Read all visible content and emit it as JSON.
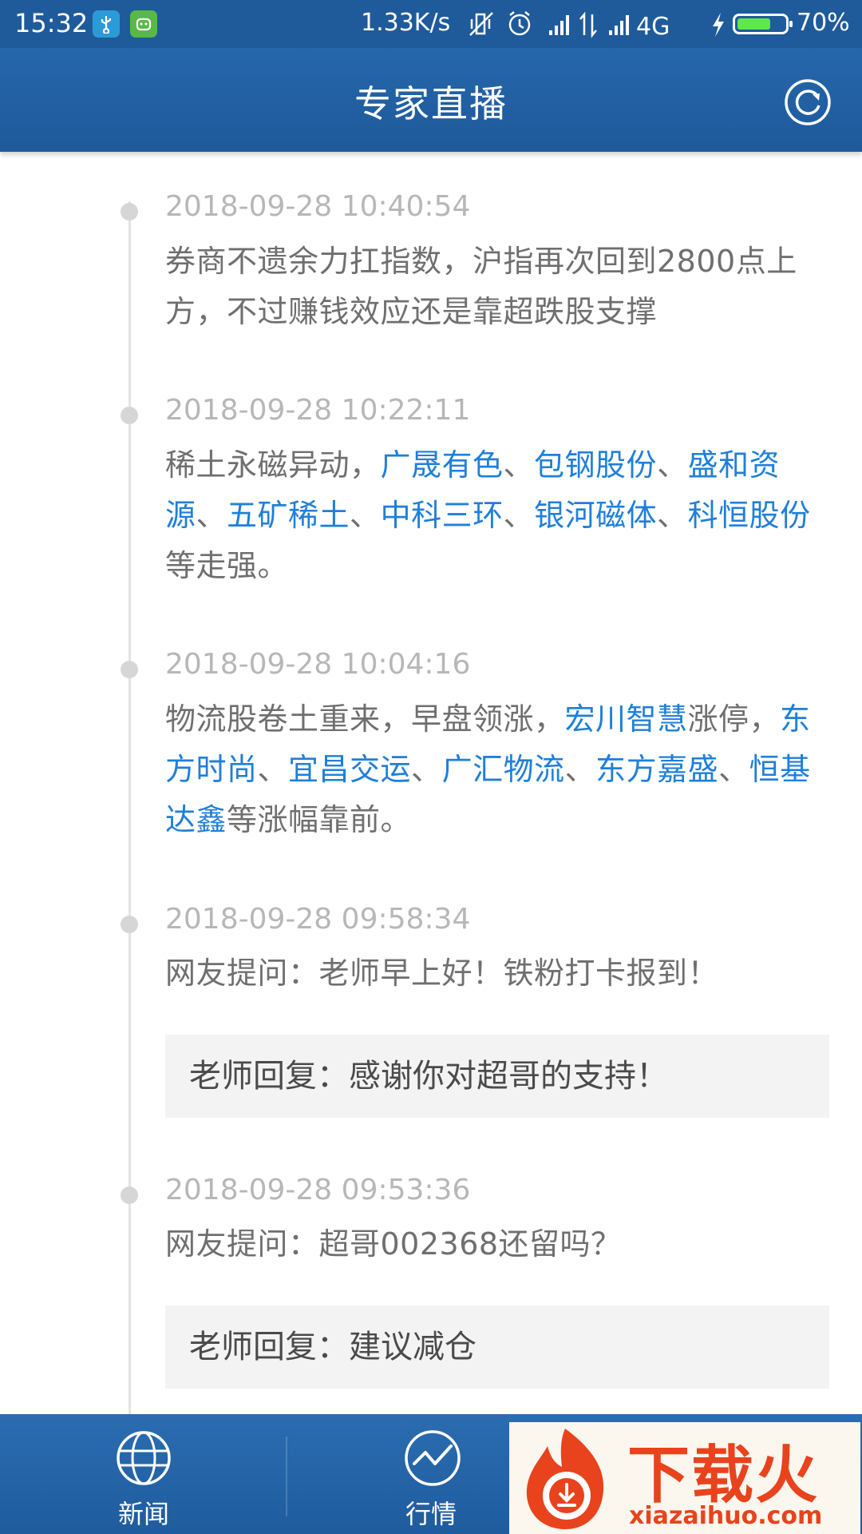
{
  "status_bar": {
    "time": "15:32",
    "net_speed": "1.33K/s",
    "network": "4G",
    "battery_percent": "70%",
    "battery_level": 0.7
  },
  "header": {
    "title": "专家直播",
    "refresh_icon": "refresh-icon"
  },
  "feed": {
    "items": [
      {
        "time": "2018-09-28 10:40:54",
        "parts": [
          {
            "t": "券商不遗余力扛指数，沪指再次回到2800点上方，不过赚钱效应还是靠超跌股支撑",
            "link": false
          }
        ]
      },
      {
        "time": "2018-09-28 10:22:11",
        "parts": [
          {
            "t": "稀土永磁异动，",
            "link": false
          },
          {
            "t": "广晟有色",
            "link": true
          },
          {
            "t": "、",
            "link": false
          },
          {
            "t": "包钢股份",
            "link": true
          },
          {
            "t": "、",
            "link": false
          },
          {
            "t": "盛和资源",
            "link": true
          },
          {
            "t": "、",
            "link": false
          },
          {
            "t": "五矿稀土",
            "link": true
          },
          {
            "t": "、",
            "link": false
          },
          {
            "t": "中科三环",
            "link": true
          },
          {
            "t": "、",
            "link": false
          },
          {
            "t": "银河磁体",
            "link": true
          },
          {
            "t": "、",
            "link": false
          },
          {
            "t": "科恒股份",
            "link": true
          },
          {
            "t": "等走强。",
            "link": false
          }
        ]
      },
      {
        "time": "2018-09-28 10:04:16",
        "parts": [
          {
            "t": "物流股卷土重来，早盘领涨，",
            "link": false
          },
          {
            "t": "宏川智慧",
            "link": true
          },
          {
            "t": "涨停，",
            "link": false
          },
          {
            "t": "东方时尚",
            "link": true
          },
          {
            "t": "、",
            "link": false
          },
          {
            "t": "宜昌交运",
            "link": true
          },
          {
            "t": "、",
            "link": false
          },
          {
            "t": "广汇物流",
            "link": true
          },
          {
            "t": "、",
            "link": false
          },
          {
            "t": "东方嘉盛",
            "link": true
          },
          {
            "t": "、",
            "link": false
          },
          {
            "t": "恒基达鑫",
            "link": true
          },
          {
            "t": "等涨幅靠前。",
            "link": false
          }
        ]
      },
      {
        "time": "2018-09-28 09:58:34",
        "parts": [
          {
            "t": "网友提问：老师早上好！铁粉打卡报到！",
            "link": false
          }
        ],
        "reply": "老师回复：感谢你对超哥的支持！"
      },
      {
        "time": "2018-09-28 09:53:36",
        "parts": [
          {
            "t": "网友提问：超哥002368还留吗？",
            "link": false
          }
        ],
        "reply": "老师回复：建议减仓"
      }
    ]
  },
  "bottom_nav": {
    "items": [
      {
        "label": "新闻",
        "icon": "globe-icon"
      },
      {
        "label": "行情",
        "icon": "trend-chart-icon"
      }
    ]
  },
  "watermark": {
    "title": "下载火",
    "url": "xiazaihuo.com"
  }
}
